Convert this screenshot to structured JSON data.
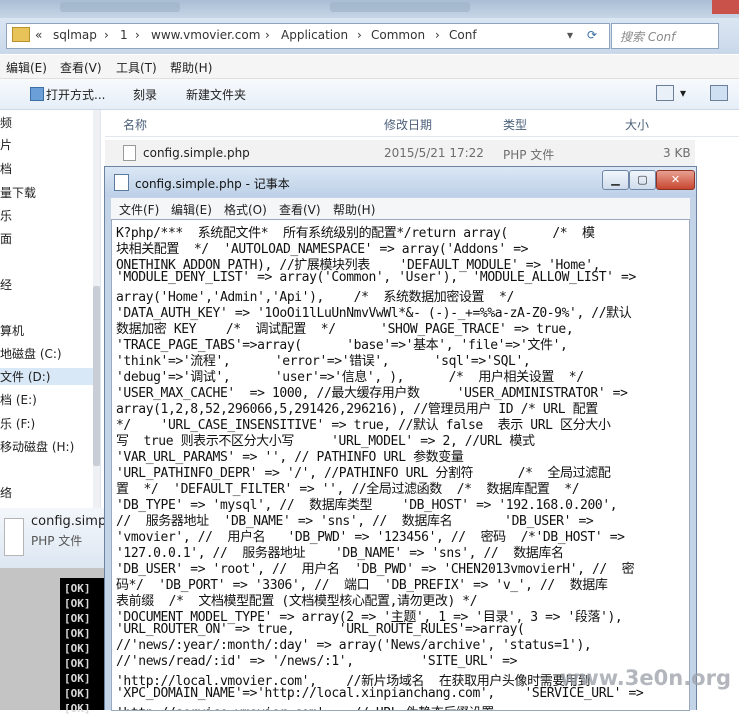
{
  "explorer": {
    "address": {
      "crumbs": [
        "sqlmap",
        "1",
        "www.vmovier.com",
        "Application",
        "Common",
        "Conf"
      ],
      "prefix": "«"
    },
    "search_placeholder": "搜索 Conf",
    "menu": [
      "编辑(E)",
      "查看(V)",
      "工具(T)",
      "帮助(H)"
    ],
    "toolbar": {
      "open_with": "打开方式...",
      "burn": "刻录",
      "new_folder": "新建文件夹"
    },
    "nav_items": [
      "频",
      "片",
      "档",
      "量下载",
      "乐",
      "面",
      "经",
      "组",
      "算机",
      "地磁盘 (C:)",
      "文件 (D:)",
      "档 (E:)",
      "乐 (F:)",
      "移动磁盘 (H:)",
      "络"
    ],
    "columns": {
      "name": "名称",
      "modified": "修改日期",
      "type": "类型",
      "size": "大小"
    },
    "file": {
      "name": "config.simple.php",
      "modified": "2015/5/21 17:22",
      "type": "PHP 文件",
      "size": "3 KB"
    },
    "details": {
      "name": "config.simple.php",
      "type": "PHP 文件"
    },
    "console_lines": [
      "[OK]",
      "[OK]",
      "[OK]",
      "[OK]",
      "[OK]",
      "[OK]",
      "[OK]",
      "[OK]",
      "[OK]"
    ]
  },
  "notepad": {
    "title": "config.simple.php - 记事本",
    "menu": [
      "文件(F)",
      "编辑(E)",
      "格式(O)",
      "查看(V)",
      "帮助(H)"
    ],
    "lines": [
      "K?php/***  系统配文件*  所有系统级别的配置*/return array(      /*  模",
      "块相关配置  */  'AUTOLOAD_NAMESPACE' => array('Addons' =>",
      "ONETHINK_ADDON_PATH), //扩展模块列表    'DEFAULT_MODULE' => 'Home',",
      "'MODULE_DENY_LIST' => array('Common', 'User'),  'MODULE_ALLOW_LIST' =>",
      "array('Home','Admin','Api'),    /*  系统数据加密设置  */",
      "'DATA_AUTH_KEY' => '1OoOi1lLuUnNmvVwWl*&- (-)-_+=%%a-zA-Z0-9%', //默认",
      "数据加密 KEY    /*  调试配置  */      'SHOW_PAGE_TRACE' => true,",
      "'TRACE_PAGE_TABS'=>array(      'base'=>'基本', 'file'=>'文件',",
      "'think'=>'流程',      'error'=>'错误',      'sql'=>'SQL',",
      "'debug'=>'调试',      'user'=>'信息', ),      /*  用户相关设置  */",
      "'USER_MAX_CACHE'  => 1000, //最大缓存用户数     'USER_ADMINISTRATOR' =>",
      "array(1,2,8,52,296066,5,291426,296216), //管理员用户 ID /* URL 配置",
      "*/    'URL_CASE_INSENSITIVE' => true, //默认 false  表示 URL 区分大小",
      "写  true 则表示不区分大小写     'URL_MODEL' => 2, //URL 模式",
      "'VAR_URL_PARAMS' => '', // PATHINFO URL 参数变量",
      "'URL_PATHINFO_DEPR' => '/', //PATHINFO URL 分割符      /*  全局过滤配",
      "置  */  'DEFAULT_FILTER' => '', //全局过滤函数  /*  数据库配置  */",
      "'DB_TYPE' => 'mysql', //  数据库类型    'DB_HOST' => '192.168.0.200',",
      "//  服务器地址  'DB_NAME' => 'sns', //  数据库名       'DB_USER' =>",
      "'vmovier', //  用户名   'DB_PWD' => '123456', //  密码  /*'DB_HOST' =>",
      "'127.0.0.1', //  服务器地址    'DB_NAME' => 'sns', //  数据库名",
      "'DB_USER' => 'root', //  用户名  'DB_PWD' => 'CHEN2013vmovierH', //  密",
      "码*/  'DB_PORT' => '3306', //  端口  'DB_PREFIX' => 'v_', //  数据库",
      "表前缀  /*  文档模型配置 (文档模型核心配置,请勿更改) */",
      "'DOCUMENT_MODEL_TYPE' => array(2 => '主题', 1 => '目录', 3 => '段落'),",
      "'URL_ROUTER_ON' => true,      'URL_ROUTE_RULES'=>array(",
      "//'news/:year/:month/:day' => array('News/archive', 'status=1'),",
      "//'news/read/:id' => '/news/:1',         'SITE_URL' =>",
      "'http://local.vmovier.com',    //新片场域名  在获取用户头像时需要用到",
      "'XPC_DOMAIN_NAME'=>'http://local.xinpianchang.com',    'SERVICE_URL' =>",
      "'http://service.vmovier.com',   // URL 伪静态后缀设置"
    ]
  },
  "watermark": "www.3e0n.org"
}
